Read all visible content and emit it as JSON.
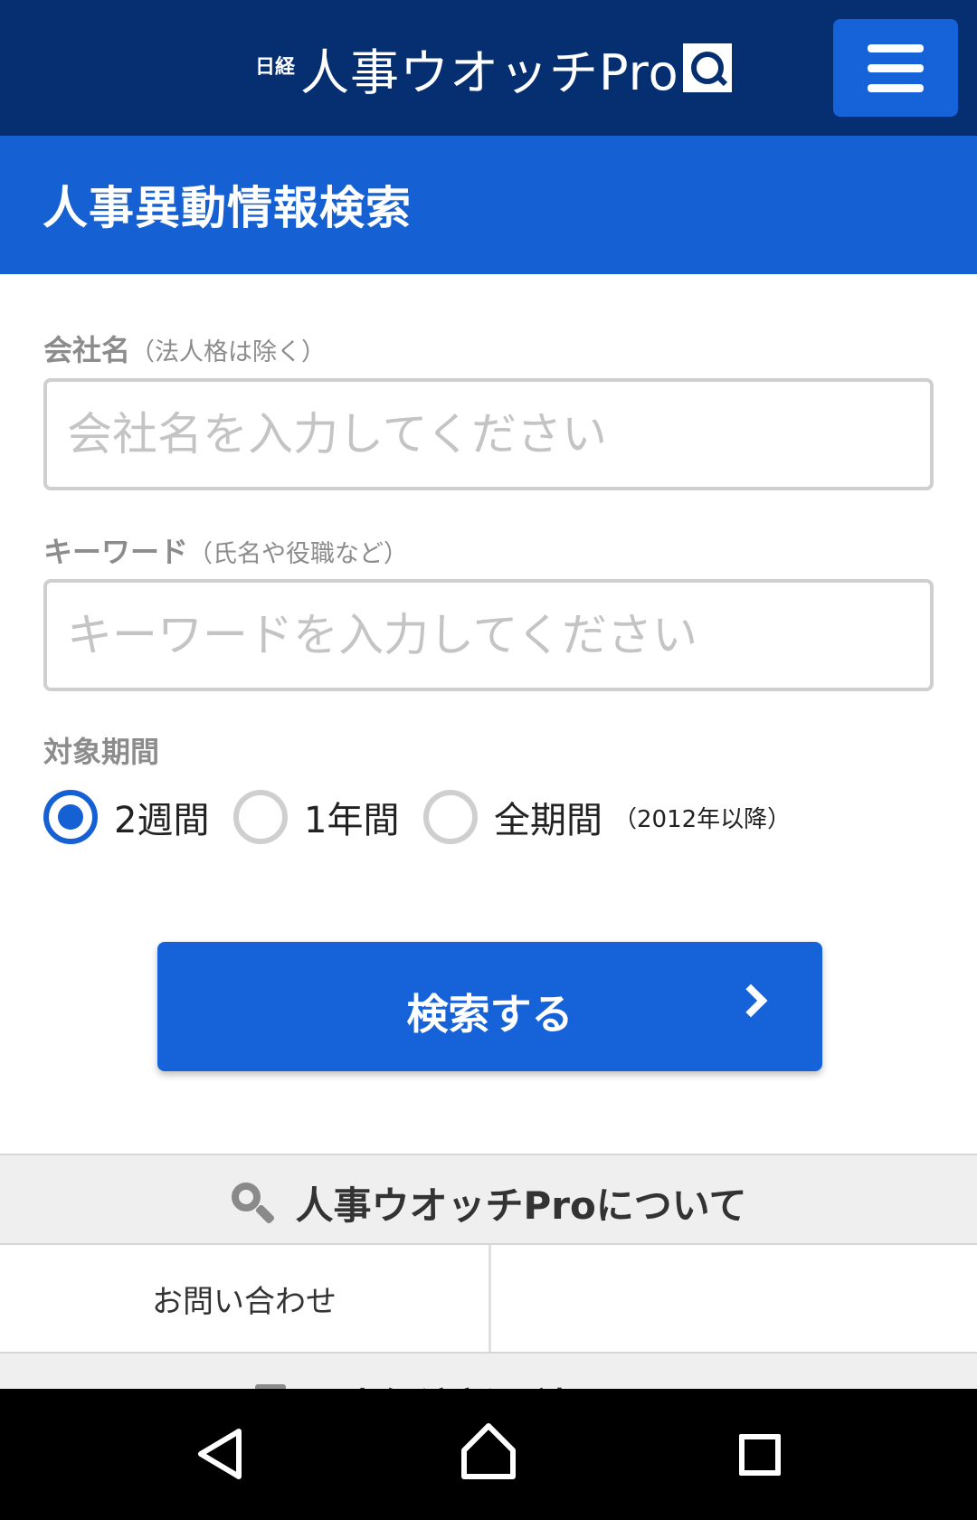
{
  "header": {
    "logo_prefix": "日経",
    "logo_text": "人事ウオッチPro",
    "logo_icon": "q-search-icon",
    "menu_icon": "hamburger-icon"
  },
  "page": {
    "title": "人事異動情報検索"
  },
  "form": {
    "company": {
      "label": "会社名",
      "note": "（法人格は除く）",
      "placeholder": "会社名を入力してください",
      "value": ""
    },
    "keyword": {
      "label": "キーワード",
      "note": "（氏名や役職など）",
      "placeholder": "キーワードを入力してください",
      "value": ""
    },
    "period": {
      "label": "対象期間",
      "options": [
        {
          "label": "2週間",
          "checked": true
        },
        {
          "label": "1年間",
          "checked": false
        },
        {
          "label": "全期間",
          "note": "（2012年以降）",
          "checked": false
        }
      ]
    },
    "submit_label": "検索する"
  },
  "footer": {
    "about_label": "人事ウオッチProについて",
    "contact_label": "お問い合わせ",
    "company_label": "日本経済新聞社について"
  },
  "colors": {
    "header_bg": "#062f72",
    "accent": "#1560d2",
    "button": "#1663d9"
  }
}
